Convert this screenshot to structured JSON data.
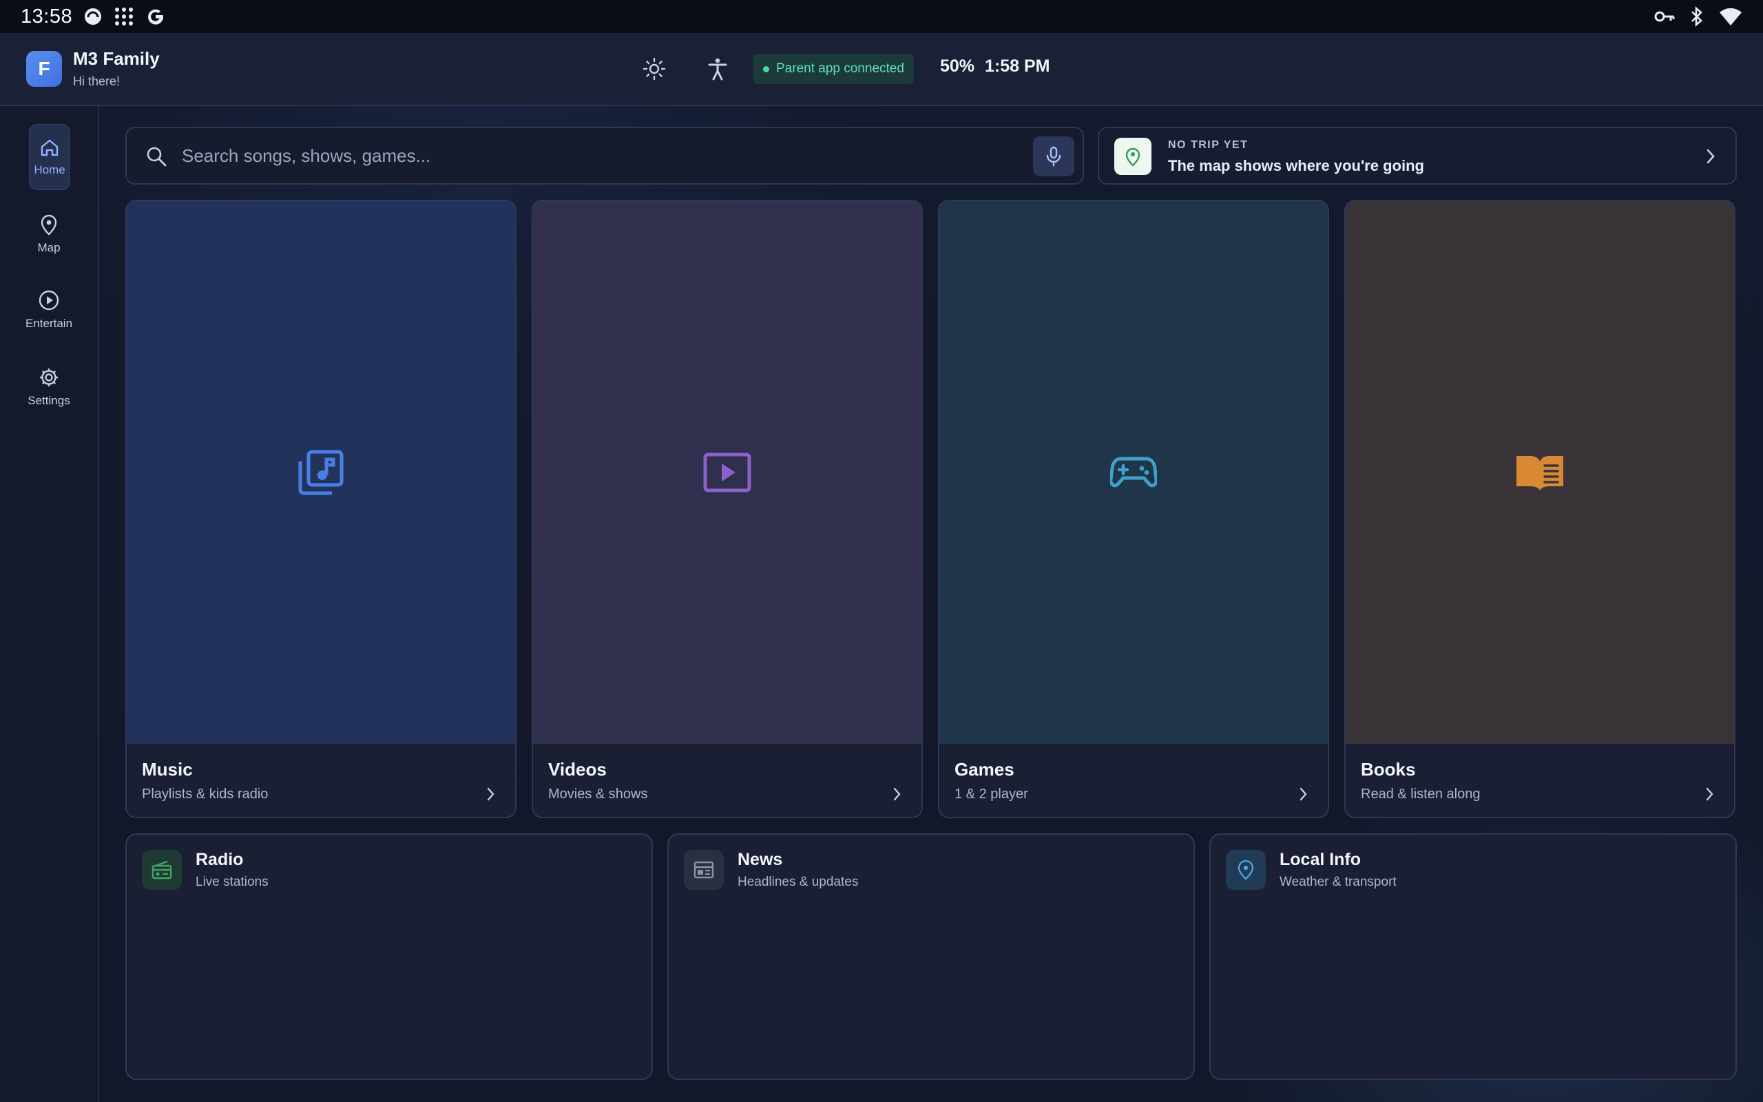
{
  "statusbar": {
    "time": "13:58",
    "icons": [
      "pocket-casts-icon",
      "app-grid-icon",
      "google-icon",
      "key-icon",
      "bluetooth-icon",
      "wifi-icon"
    ]
  },
  "header": {
    "avatar_initial": "F",
    "name": "M3 Family",
    "greeting": "Hi there!",
    "connection_status": "Parent app connected",
    "battery": "50%",
    "clock": "1:58 PM"
  },
  "sidebar": {
    "items": [
      {
        "label": "Home",
        "icon": "home-icon",
        "active": true
      },
      {
        "label": "Map",
        "icon": "map-pin-icon",
        "active": false
      },
      {
        "label": "Entertain",
        "icon": "play-circle-icon",
        "active": false
      },
      {
        "label": "Settings",
        "icon": "gear-icon",
        "active": false
      }
    ]
  },
  "search": {
    "placeholder": "Search songs, shows, games...",
    "value": ""
  },
  "trip": {
    "kicker": "NO TRIP YET",
    "text": "The map shows where you're going"
  },
  "tiles": [
    {
      "title": "Music",
      "subtitle": "Playlists & kids radio",
      "icon": "music-library-icon",
      "bg": "#21335a",
      "accent": "#4a7ee6"
    },
    {
      "title": "Videos",
      "subtitle": "Movies & shows",
      "icon": "video-play-icon",
      "bg": "#302f4e",
      "accent": "#8a63c9"
    },
    {
      "title": "Games",
      "subtitle": "1 & 2 player",
      "icon": "gamepad-icon",
      "bg": "#1f364a",
      "accent": "#3fa0c8"
    },
    {
      "title": "Books",
      "subtitle": "Read & listen along",
      "icon": "open-book-icon",
      "bg": "#3a3439",
      "accent": "#d98834"
    }
  ],
  "cards": [
    {
      "title": "Radio",
      "subtitle": "Live stations",
      "icon": "radio-icon",
      "accent": "#3fa564",
      "icon_bg": "#1f3a33"
    },
    {
      "title": "News",
      "subtitle": "Headlines & updates",
      "icon": "newspaper-icon",
      "accent": "#8b93a8",
      "icon_bg": "#2a3042"
    },
    {
      "title": "Local Info",
      "subtitle": "Weather & transport",
      "icon": "location-pin-icon",
      "accent": "#4fa3e0",
      "icon_bg": "#213a55"
    }
  ]
}
